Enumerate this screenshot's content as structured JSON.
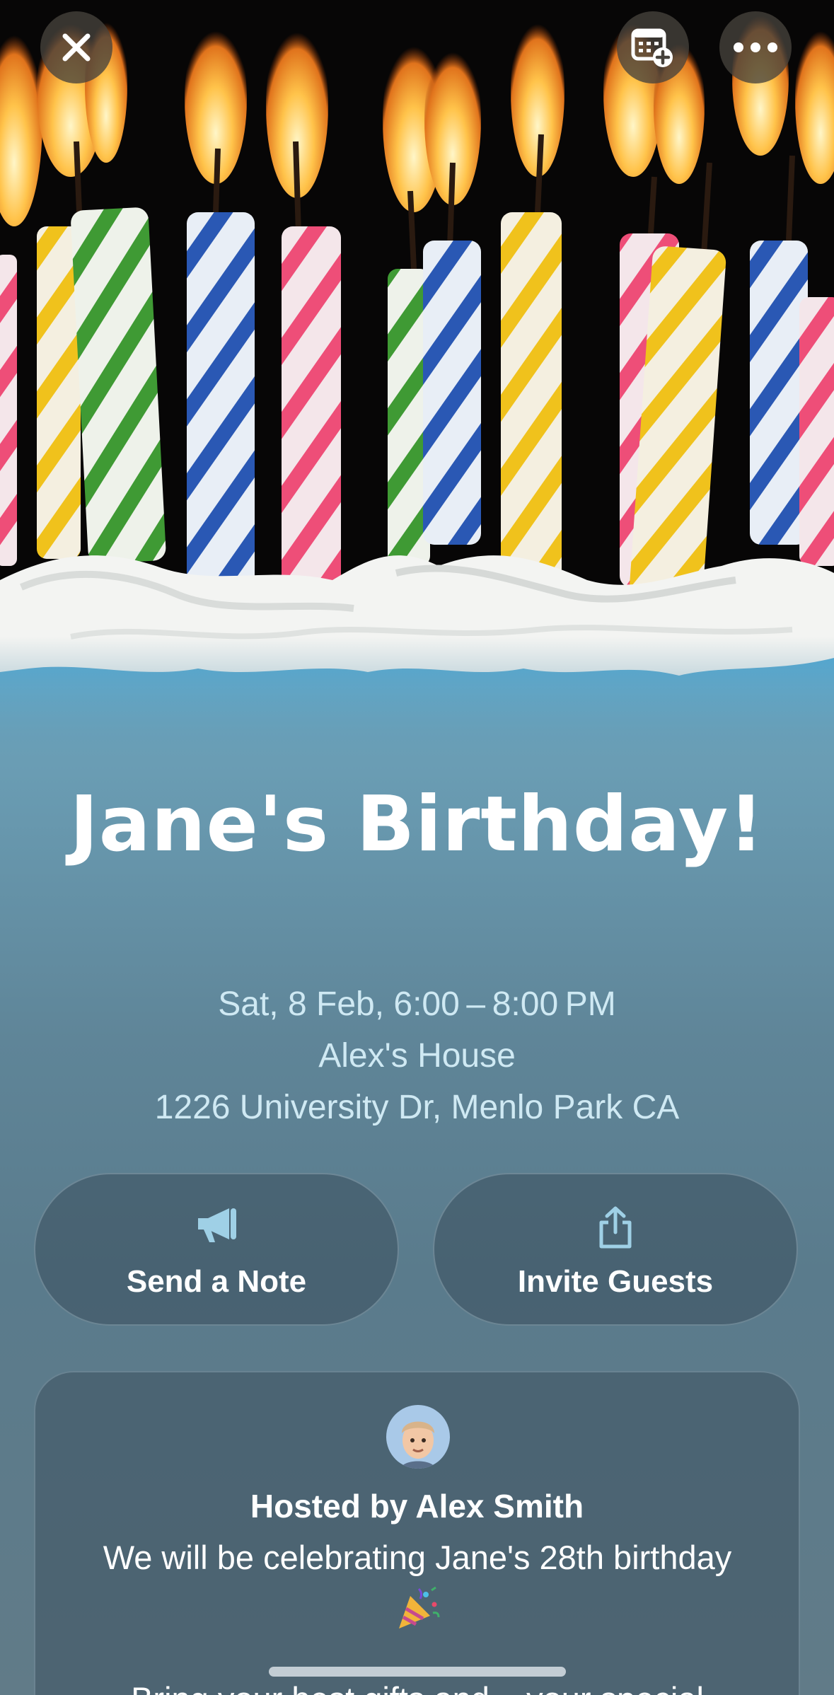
{
  "toolbar": {
    "close_icon": "close-icon",
    "calendar_icon": "calendar-add-icon",
    "more_icon": "more-ellipsis-icon"
  },
  "event": {
    "title": "Jane's Birthday!",
    "datetime": "Sat, 8 Feb, 6:00 – 8:00 PM",
    "place": "Alex's House",
    "address": "1226 University Dr, Menlo Park CA"
  },
  "actions": {
    "send_note": {
      "label": "Send a Note",
      "icon": "megaphone-icon"
    },
    "invite_guests": {
      "label": "Invite Guests",
      "icon": "share-icon"
    }
  },
  "host": {
    "name": "Hosted by Alex Smith",
    "message": "We will be celebrating Jane's 28th birthday",
    "emoji": "party-popper-icon",
    "message_continued": "Bring your best gifts and ...your special"
  },
  "colors": {
    "title": "#ffffff",
    "details": "#cfe9f3",
    "button_fill": "#3a4e5c",
    "frosting_blue": "#5fa8cf"
  }
}
